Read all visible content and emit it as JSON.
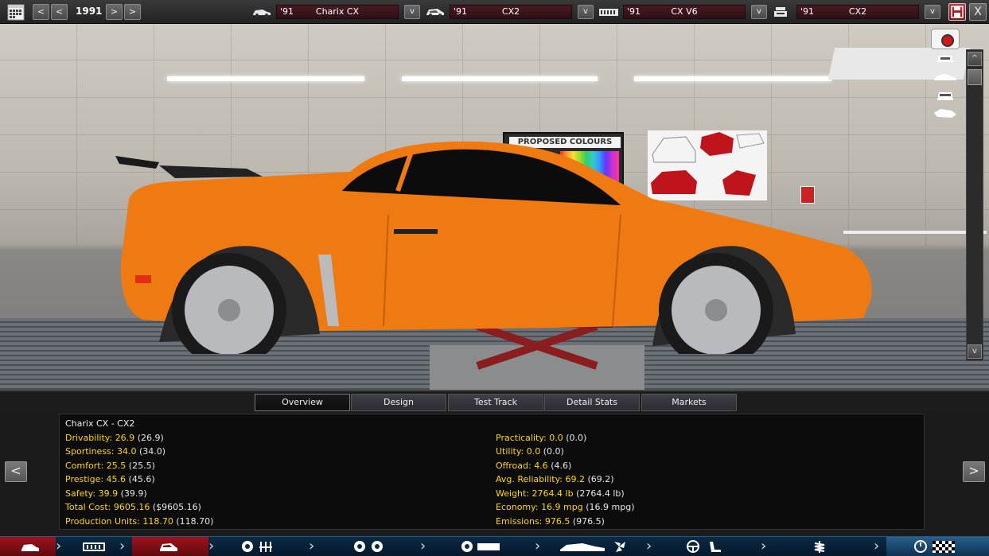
{
  "topbar": {
    "calendar_icon": "calendar-icon",
    "year": "1991",
    "prev_label": "<",
    "prev_fast_label": "<",
    "next_label": ">",
    "next_fast_label": ">",
    "selectors": [
      {
        "icon": "car-model-icon",
        "year": "'91",
        "name": "Charix CX",
        "dropdown": "v"
      },
      {
        "icon": "car-trim-icon",
        "year": "'91",
        "name": "CX2",
        "dropdown": "v"
      },
      {
        "icon": "engine-icon",
        "year": "'91",
        "name": "CX V6",
        "dropdown": "v"
      },
      {
        "icon": "engine-variant-icon",
        "year": "'91",
        "name": "CX2",
        "dropdown": "v"
      }
    ],
    "save_icon": "save-icon",
    "close_label": "X"
  },
  "scene": {
    "poster_title": "PROPOSED COLOURS",
    "scroll_up": "^",
    "scroll_down": "v"
  },
  "tabs": [
    {
      "label": "Overview",
      "active": true
    },
    {
      "label": "Design",
      "active": false
    },
    {
      "label": "Test Track",
      "active": false
    },
    {
      "label": "Detail Stats",
      "active": false
    },
    {
      "label": "Markets",
      "active": false
    }
  ],
  "panel": {
    "prev_label": "<",
    "next_label": ">",
    "title": "Charix CX - CX2",
    "left_stats": [
      {
        "label": "Drivability:",
        "value": "26.9",
        "paren": "(26.9)"
      },
      {
        "label": "Sportiness:",
        "value": "34.0",
        "paren": "(34.0)"
      },
      {
        "label": "Comfort:",
        "value": "25.5",
        "paren": "(25.5)"
      },
      {
        "label": "Prestige:",
        "value": "45.6",
        "paren": "(45.6)"
      },
      {
        "label": "Safety:",
        "value": "39.9",
        "paren": "(39.9)"
      },
      {
        "label": "Total Cost:",
        "value": "9605.16",
        "paren": "($9605.16)"
      },
      {
        "label": "Production Units:",
        "value": "118.70",
        "paren": "(118.70)"
      }
    ],
    "right_stats": [
      {
        "label": "Practicality:",
        "value": "0.0",
        "paren": "(0.0)"
      },
      {
        "label": "Utility:",
        "value": "0.0",
        "paren": "(0.0)"
      },
      {
        "label": "Offroad:",
        "value": "4.6",
        "paren": "(4.6)"
      },
      {
        "label": "Avg. Reliability:",
        "value": "69.2",
        "paren": "(69.2)"
      },
      {
        "label": "Weight:",
        "value": "2764.4 lb",
        "paren": "(2764.4 lb)"
      },
      {
        "label": "Economy:",
        "value": "16.9 mpg",
        "paren": "(16.9 mpg)"
      },
      {
        "label": "Emissions:",
        "value": "976.5",
        "paren": "(976.5)"
      }
    ]
  },
  "colors": {
    "stat_yellow": "#ffd800",
    "car_orange": "#f07a12",
    "nav_active_red": "#a0121b",
    "nav_blue": "#0a2a44"
  }
}
